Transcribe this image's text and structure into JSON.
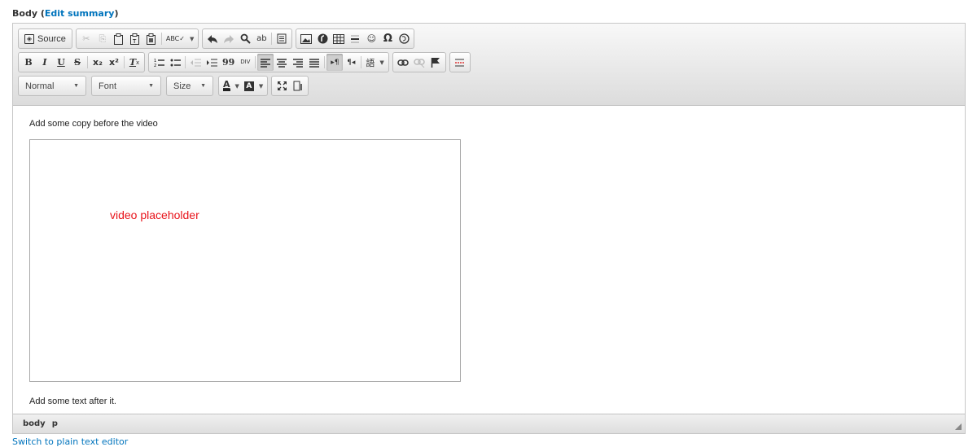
{
  "field": {
    "label": "Body",
    "open_paren": " (",
    "edit_summary": "Edit summary",
    "close_paren": ")"
  },
  "toolbar": {
    "source": "Source",
    "cut": "✂",
    "copy": "⎘",
    "paste": "📋",
    "paste_text": "📋",
    "paste_word": "📋",
    "spellcheck": "ABC✓",
    "undo": "◀",
    "redo": "➦",
    "find": "🔍",
    "replace": "ab",
    "select_all": "▤",
    "image": "▭",
    "flash": "●",
    "table": "▦",
    "hr": "☰",
    "smiley": "☺",
    "omega": "Ω",
    "iframe": "⊛",
    "bold": "B",
    "italic": "I",
    "underline": "U",
    "strike": "S",
    "subscript": "x₂",
    "superscript": "x²",
    "remove_format": "T",
    "remove_format_sub": "x",
    "ordered_list": "≔",
    "bulleted_list": "⁝≡",
    "outdent": "⇤",
    "indent": "⇥",
    "blockquote": "99",
    "creatediv": "DIV",
    "align_left": "≡",
    "align_center": "≡",
    "align_right": "≡",
    "justify": "≣",
    "ltr": "▸¶",
    "rtl": "¶◂",
    "language": "語",
    "link": "⊝",
    "unlink": "⊘",
    "anchor": "⚑",
    "pagebreak": "☰",
    "format": "Normal",
    "font": "Font",
    "size": "Size",
    "text_color": "A",
    "bg_color": "A",
    "maximize": "⤢",
    "show_blocks": "▯"
  },
  "content": {
    "before": "Add some copy before the video",
    "video_placeholder": "video placeholder",
    "after": "Add some text after it."
  },
  "statusbar": {
    "path": [
      "body",
      "p"
    ]
  },
  "switch_editor": "Switch to plain text editor"
}
